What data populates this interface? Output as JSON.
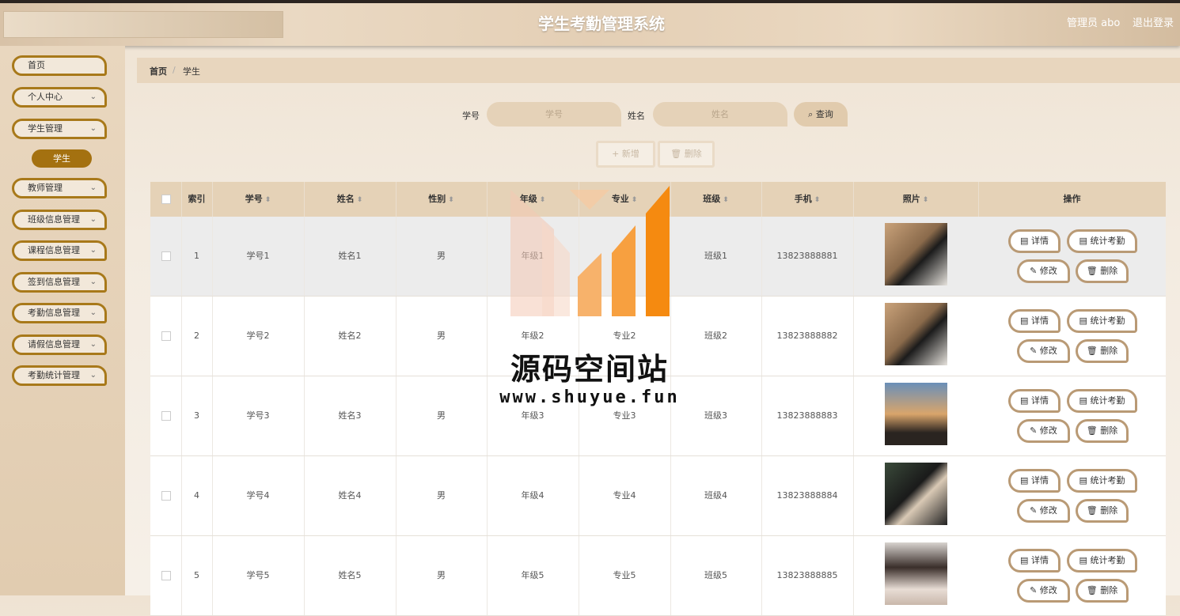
{
  "header": {
    "title": "学生考勤管理系统",
    "user": "管理员 abo",
    "logout": "退出登录"
  },
  "sidebar": {
    "items": [
      {
        "label": "首页"
      },
      {
        "label": "个人中心"
      },
      {
        "label": "学生管理"
      },
      {
        "label": "教师管理"
      },
      {
        "label": "班级信息管理"
      },
      {
        "label": "课程信息管理"
      },
      {
        "label": "签到信息管理"
      },
      {
        "label": "考勤信息管理"
      },
      {
        "label": "请假信息管理"
      },
      {
        "label": "考勤统计管理"
      }
    ],
    "active_sub": "学生"
  },
  "breadcrumb": {
    "home": "首页",
    "sep": "/",
    "current": "学生"
  },
  "search": {
    "id_label": "学号",
    "id_placeholder": "学号",
    "name_label": "姓名",
    "name_placeholder": "姓名",
    "query": "查询"
  },
  "toolbar": {
    "add": "+ 新增",
    "delete": "删除"
  },
  "table": {
    "headers": [
      "索引",
      "学号",
      "姓名",
      "性别",
      "年级",
      "专业",
      "班级",
      "手机",
      "照片",
      "操作"
    ],
    "rows": [
      {
        "index": "1",
        "id": "学号1",
        "name": "姓名1",
        "gender": "男",
        "grade": "年级1",
        "major": "专业1",
        "class": "班级1",
        "phone": "13823888881"
      },
      {
        "index": "2",
        "id": "学号2",
        "name": "姓名2",
        "gender": "男",
        "grade": "年级2",
        "major": "专业2",
        "class": "班级2",
        "phone": "13823888882"
      },
      {
        "index": "3",
        "id": "学号3",
        "name": "姓名3",
        "gender": "男",
        "grade": "年级3",
        "major": "专业3",
        "class": "班级3",
        "phone": "13823888883"
      },
      {
        "index": "4",
        "id": "学号4",
        "name": "姓名4",
        "gender": "男",
        "grade": "年级4",
        "major": "专业4",
        "class": "班级4",
        "phone": "13823888884"
      },
      {
        "index": "5",
        "id": "学号5",
        "name": "姓名5",
        "gender": "男",
        "grade": "年级5",
        "major": "专业5",
        "class": "班级5",
        "phone": "13823888885"
      }
    ],
    "actions": {
      "detail": "详情",
      "stats": "统计考勤",
      "edit": "修改",
      "delete": "删除"
    }
  },
  "watermark": {
    "text": "源码空间站",
    "url": "www.shuyue.fun"
  }
}
